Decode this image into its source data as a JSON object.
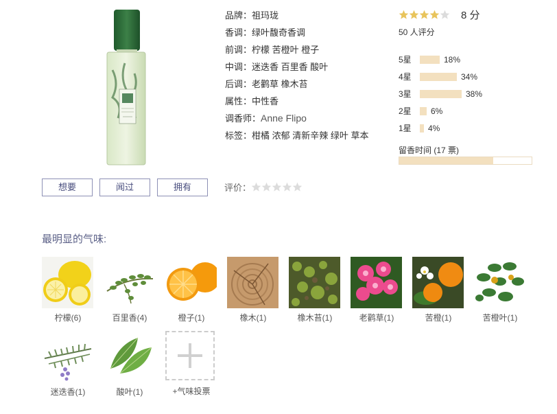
{
  "info": {
    "brand": {
      "key": "品牌：",
      "value": "祖玛珑"
    },
    "accord": {
      "key": "香调：",
      "value": "绿叶馥奇香调"
    },
    "top": {
      "key": "前调：",
      "value": "柠檬 苦橙叶 橙子"
    },
    "middle": {
      "key": "中调：",
      "value": "迷迭香 百里香 酸叶"
    },
    "base": {
      "key": "后调：",
      "value": "老鹳草 橡木苔"
    },
    "gender": {
      "key": "属性：",
      "value": "中性香"
    },
    "perfumer": {
      "key": "调香师：",
      "value": "Anne Flipo"
    },
    "tags": {
      "key": "标签：",
      "value": "柑橘 浓郁 清新辛辣 绿叶 草本"
    }
  },
  "rating": {
    "stars_filled": 4,
    "stars_total": 5,
    "score": "8 分",
    "count": "50 人评分",
    "distribution": [
      {
        "label": "5星",
        "percent": "18%",
        "fraction": 0.18
      },
      {
        "label": "4星",
        "percent": "34%",
        "fraction": 0.34
      },
      {
        "label": "3星",
        "percent": "38%",
        "fraction": 0.38
      },
      {
        "label": "2星",
        "percent": "6%",
        "fraction": 0.06
      },
      {
        "label": "1星",
        "percent": "4%",
        "fraction": 0.04
      }
    ],
    "longevity_label": "留香时间 (17 票)",
    "longevity_fraction": 0.71
  },
  "actions": {
    "want": "想要",
    "smelled": "闻过",
    "own": "拥有",
    "my_rating_label": "评价："
  },
  "section_title": "最明显的气味:",
  "notes": [
    {
      "name": "柠檬(6)",
      "icon": "lemon-icon"
    },
    {
      "name": "百里香(4)",
      "icon": "thyme-icon"
    },
    {
      "name": "橙子(1)",
      "icon": "orange-icon"
    },
    {
      "name": "橡木(1)",
      "icon": "oak-wood-icon"
    },
    {
      "name": "橡木苔(1)",
      "icon": "oakmoss-icon"
    },
    {
      "name": "老鹳草(1)",
      "icon": "geranium-icon"
    },
    {
      "name": "苦橙(1)",
      "icon": "bitter-orange-icon"
    },
    {
      "name": "苦橙叶(1)",
      "icon": "petitgrain-icon"
    },
    {
      "name": "迷迭香(1)",
      "icon": "rosemary-icon"
    },
    {
      "name": "酸叶(1)",
      "icon": "sorrel-icon"
    }
  ],
  "vote": {
    "label": "+气味投票"
  },
  "colors": {
    "accent": "#5b6087",
    "bar": "#f3e0bf",
    "star": "#e8c45c",
    "star_empty": "#dcdcdc",
    "bottle_cap": "#2d6a3a"
  }
}
